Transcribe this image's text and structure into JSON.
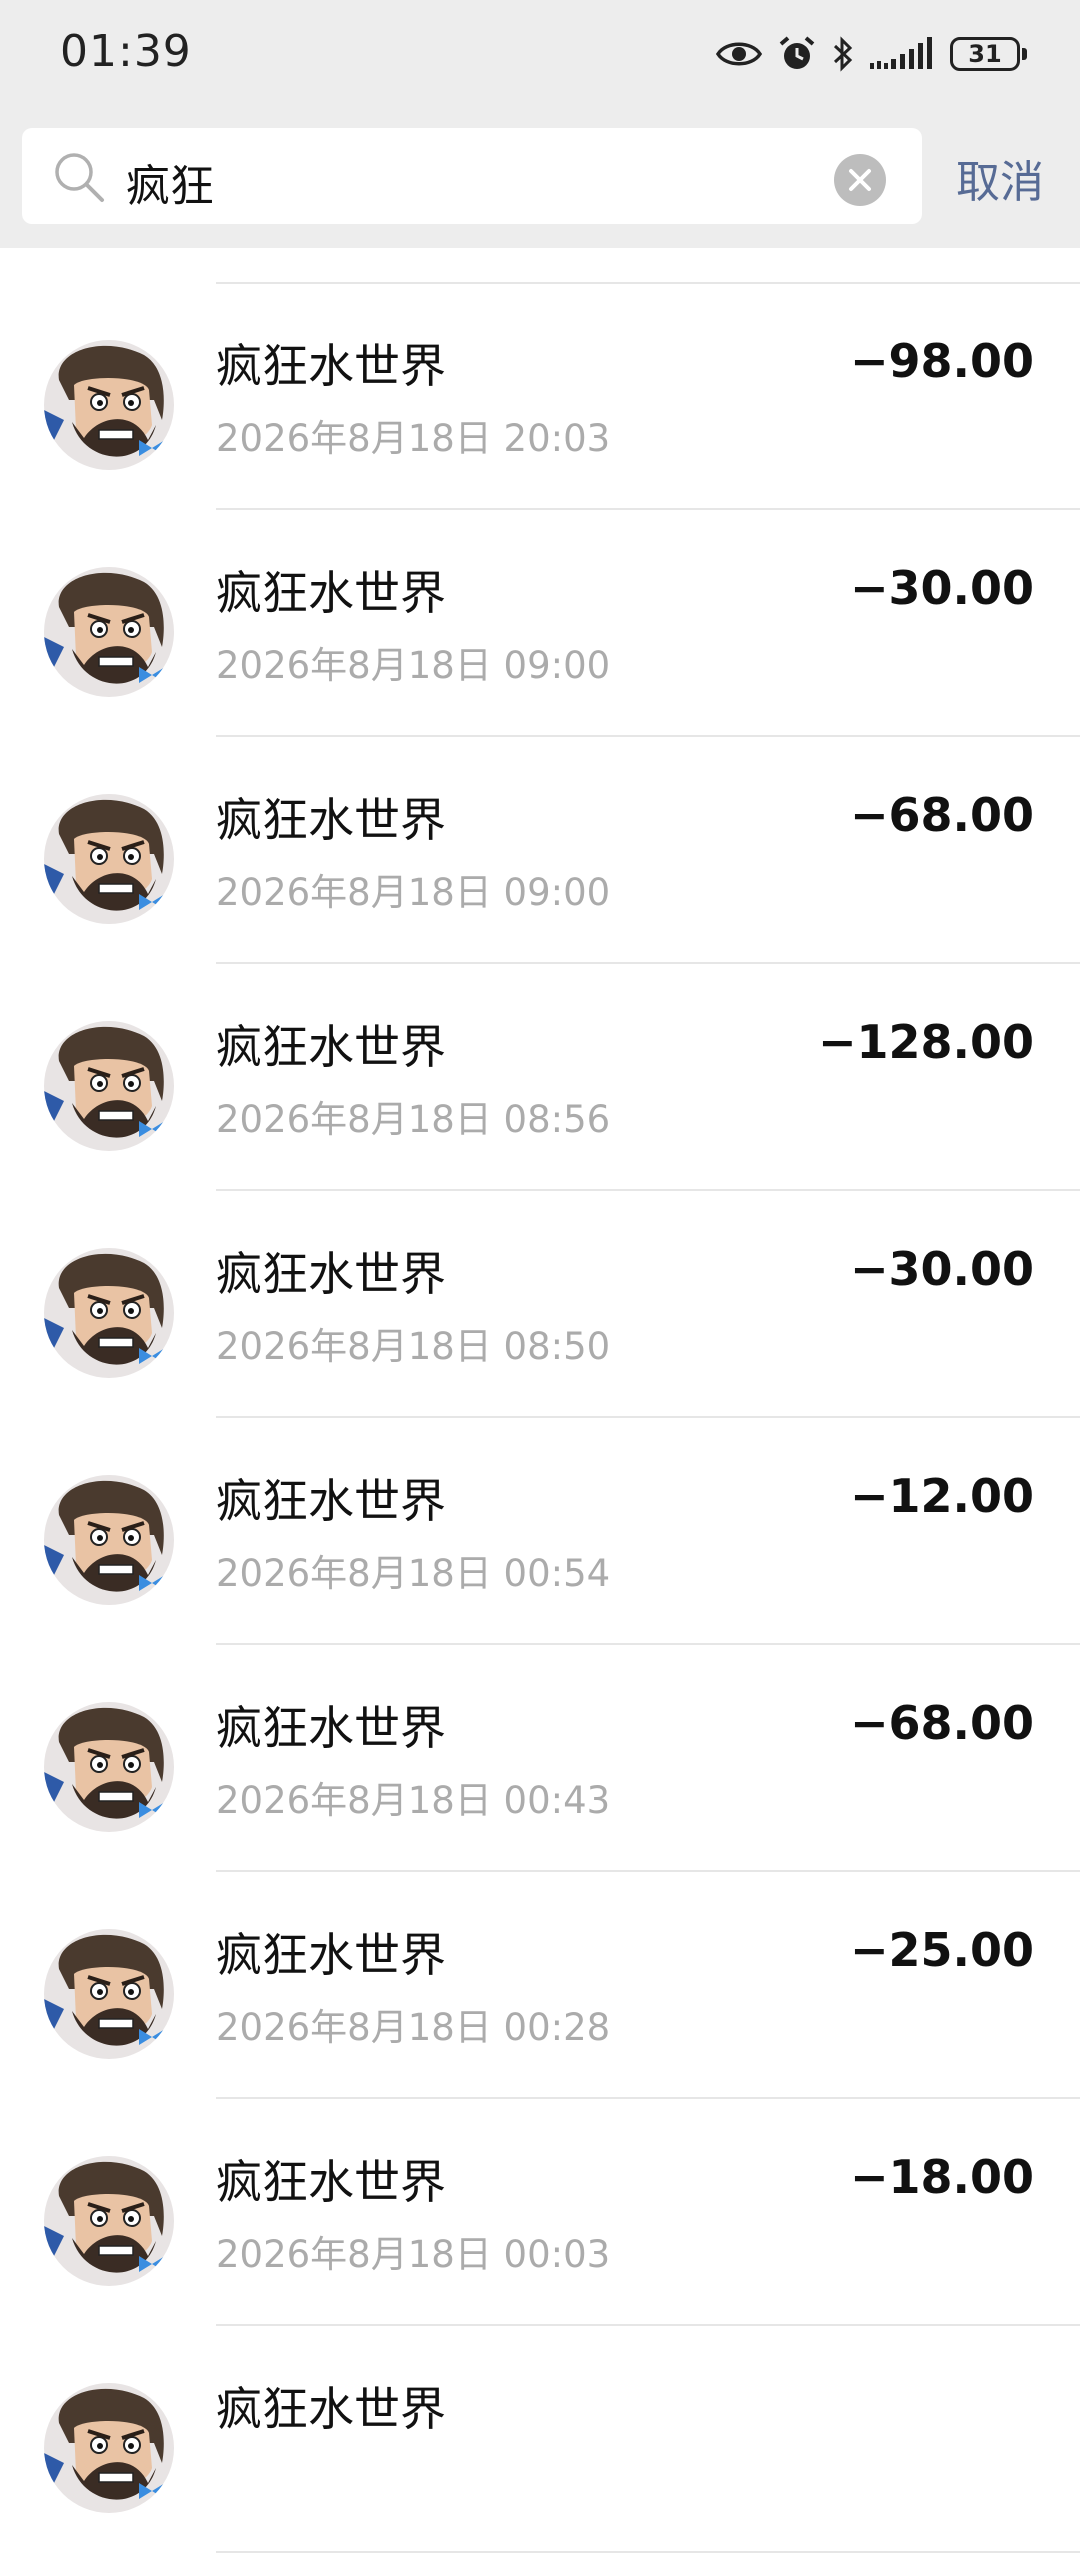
{
  "status_bar": {
    "time": "01:39",
    "battery": "31"
  },
  "search": {
    "query": "疯狂",
    "cancel_label": "取消"
  },
  "colors": {
    "accent_link": "#576b95",
    "header_bg": "#ededed",
    "secondary_text": "#ababab"
  },
  "transactions": [
    {
      "name": "疯狂水世界",
      "time": "2026年8月18日 20:03",
      "amount": "−98.00"
    },
    {
      "name": "疯狂水世界",
      "time": "2026年8月18日 09:00",
      "amount": "−30.00"
    },
    {
      "name": "疯狂水世界",
      "time": "2026年8月18日 09:00",
      "amount": "−68.00"
    },
    {
      "name": "疯狂水世界",
      "time": "2026年8月18日 08:56",
      "amount": "−128.00"
    },
    {
      "name": "疯狂水世界",
      "time": "2026年8月18日 08:50",
      "amount": "−30.00"
    },
    {
      "name": "疯狂水世界",
      "time": "2026年8月18日 00:54",
      "amount": "−12.00"
    },
    {
      "name": "疯狂水世界",
      "time": "2026年8月18日 00:43",
      "amount": "−68.00"
    },
    {
      "name": "疯狂水世界",
      "time": "2026年8月18日 00:28",
      "amount": "−25.00"
    },
    {
      "name": "疯狂水世界",
      "time": "2026年8月18日 00:03",
      "amount": "−18.00"
    },
    {
      "name": "疯狂水世界",
      "time": "",
      "amount": ""
    }
  ]
}
